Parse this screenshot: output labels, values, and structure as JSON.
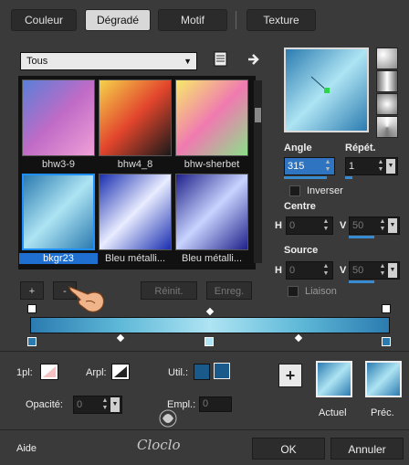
{
  "tabs": [
    {
      "label": "Couleur",
      "active": false
    },
    {
      "label": "Dégradé",
      "active": true
    },
    {
      "label": "Motif",
      "active": false
    },
    {
      "label": "Texture",
      "active": false
    }
  ],
  "category_select": {
    "value": "Tous"
  },
  "gradients": [
    {
      "label": "bhw3-9",
      "selected": false,
      "colors": [
        "#5a7fd8",
        "#c06bc6",
        "#f0a0d8"
      ]
    },
    {
      "label": "bhw4_8",
      "selected": false,
      "colors": [
        "#f6d24a",
        "#e2452d",
        "#1a1a1a"
      ]
    },
    {
      "label": "bhw-sherbet",
      "selected": false,
      "colors": [
        "#f7e96a",
        "#f07ab0",
        "#8be08a"
      ]
    },
    {
      "label": "bkgr23",
      "selected": true,
      "colors": [
        "#2b7bb0",
        "#aee4f3",
        "#2b7bb0"
      ]
    },
    {
      "label": "Bleu métalli...",
      "selected": false,
      "colors": [
        "#1a2fb0",
        "#e8ecff",
        "#1a2fb0"
      ]
    },
    {
      "label": "Bleu métalli...",
      "selected": false,
      "colors": [
        "#20208a",
        "#c8d4ff",
        "#20208a"
      ]
    }
  ],
  "list_buttons": {
    "add": "+",
    "remove": "-",
    "reset": "Réinit.",
    "save": "Enreg."
  },
  "angle": {
    "label": "Angle",
    "value": "315"
  },
  "repeat": {
    "label": "Répét.",
    "value": "1"
  },
  "invert": {
    "label": "Inverser",
    "checked": false
  },
  "center": {
    "label": "Centre",
    "h_label": "H",
    "h_value": "0",
    "v_label": "V",
    "v_value": "50"
  },
  "source": {
    "label": "Source",
    "h_label": "H",
    "h_value": "0",
    "v_label": "V",
    "v_value": "50"
  },
  "link": {
    "label": "Liaison",
    "checked": false
  },
  "stops": {
    "p1_label": "1pl:",
    "arpl_label": "Arpl:",
    "util_label": "Util.:",
    "opacity_label": "Opacité:",
    "opacity_value": "0",
    "empl_label": "Empl.:",
    "empl_value": "0"
  },
  "swatches": {
    "add_icon": "+",
    "current_label": "Actuel",
    "previous_label": "Préc."
  },
  "footer": {
    "help": "Aide",
    "ok": "OK",
    "cancel": "Annuler"
  },
  "watermark": "Cloclo",
  "colors": {
    "accent": "#1e6fd0",
    "gradient_dark": "#2b7bb0",
    "gradient_light": "#aee4f3"
  }
}
